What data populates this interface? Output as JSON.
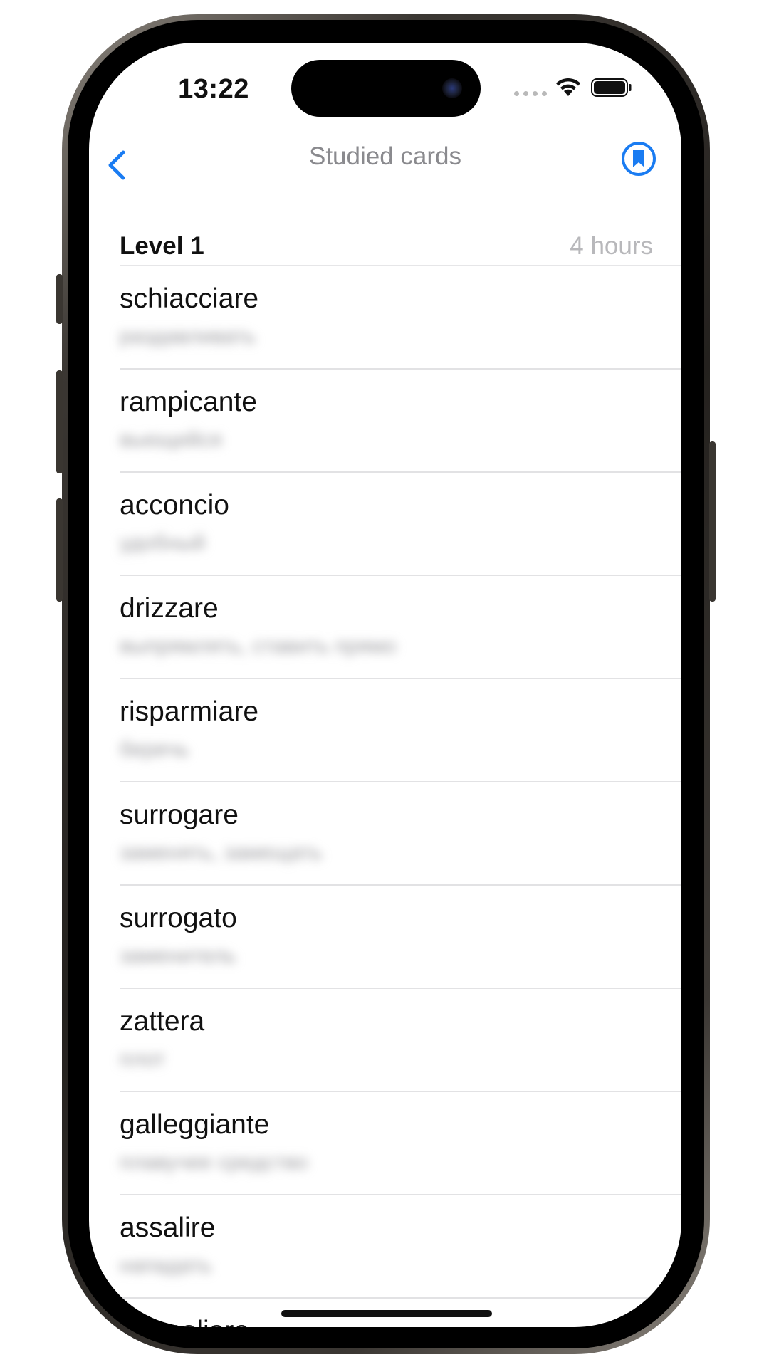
{
  "status_bar": {
    "time": "13:22",
    "icons": [
      "cellular-dots-icon",
      "wifi-icon",
      "battery-icon"
    ]
  },
  "nav": {
    "back_icon": "chevron-left-icon",
    "title": "Studied cards",
    "bookmark_icon": "bookmark-circle-icon",
    "accent_color": "#1a7cf2"
  },
  "section": {
    "title": "Level 1",
    "time": "4 hours"
  },
  "cards": [
    {
      "word": "schiacciare",
      "translation": "раздавливать"
    },
    {
      "word": "rampicante",
      "translation": "вьющийся"
    },
    {
      "word": "acconcio",
      "translation": "удобный"
    },
    {
      "word": "drizzare",
      "translation": "выпрямлять, ставить прямо"
    },
    {
      "word": "risparmiare",
      "translation": "беречь"
    },
    {
      "word": "surrogare",
      "translation": "заменять, замещать"
    },
    {
      "word": "surrogato",
      "translation": "заменитель"
    },
    {
      "word": "zattera",
      "translation": "плот"
    },
    {
      "word": "galleggiante",
      "translation": "плавучее средство"
    },
    {
      "word": "assalire",
      "translation": "нападать"
    },
    {
      "word": "ammaliare",
      "translation": ""
    }
  ]
}
